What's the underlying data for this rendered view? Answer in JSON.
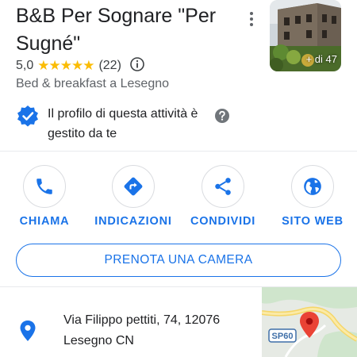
{
  "business": {
    "name": "B&B Per Sognare \"Per Sugné\"",
    "rating": "5,0",
    "stars": "★★★★★",
    "review_count": "(22)",
    "category": "Bed & breakfast a Lesegno",
    "photo_count": "+ di 47",
    "managed_text": "Il profilo di questa attività è gestito da te"
  },
  "actions": [
    {
      "label": "CHIAMA",
      "icon": "phone-icon"
    },
    {
      "label": "INDICAZIONI",
      "icon": "directions-icon"
    },
    {
      "label": "CONDIVIDI",
      "icon": "share-icon"
    },
    {
      "label": "SITO WEB",
      "icon": "globe-icon"
    }
  ],
  "book_button": "PRENOTA UNA CAMERA",
  "address": "Via Filippo pettiti, 74, 12076 Lesegno CN",
  "map": {
    "road_label": "SP60"
  },
  "colors": {
    "accent": "#1a73e8",
    "star": "#fbbc04",
    "pin": "#ea4335",
    "verified": "#1a73e8"
  }
}
